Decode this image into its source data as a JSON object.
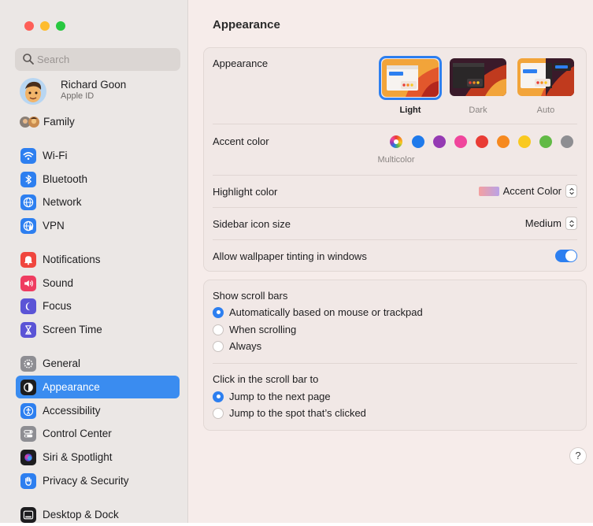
{
  "window": {
    "title": "Appearance"
  },
  "search": {
    "placeholder": "Search"
  },
  "account": {
    "name": "Richard Goon",
    "subtitle": "Apple ID"
  },
  "sidebar": {
    "items": [
      {
        "label": "Family",
        "icon": "family-avatars-icon"
      },
      {
        "label": "Wi-Fi",
        "icon": "wifi-icon"
      },
      {
        "label": "Bluetooth",
        "icon": "bluetooth-icon"
      },
      {
        "label": "Network",
        "icon": "globe-icon"
      },
      {
        "label": "VPN",
        "icon": "vpn-globe-icon"
      },
      {
        "label": "Notifications",
        "icon": "bell-icon"
      },
      {
        "label": "Sound",
        "icon": "speaker-icon"
      },
      {
        "label": "Focus",
        "icon": "moon-icon"
      },
      {
        "label": "Screen Time",
        "icon": "hourglass-icon"
      },
      {
        "label": "General",
        "icon": "gear-icon"
      },
      {
        "label": "Appearance",
        "icon": "appearance-icon",
        "selected": true
      },
      {
        "label": "Accessibility",
        "icon": "accessibility-icon"
      },
      {
        "label": "Control Center",
        "icon": "toggles-icon"
      },
      {
        "label": "Siri & Spotlight",
        "icon": "siri-icon"
      },
      {
        "label": "Privacy & Security",
        "icon": "hand-icon"
      },
      {
        "label": "Desktop & Dock",
        "icon": "dock-icon"
      }
    ]
  },
  "appearance": {
    "label": "Appearance",
    "options": [
      {
        "label": "Light",
        "selected": true
      },
      {
        "label": "Dark",
        "selected": false
      },
      {
        "label": "Auto",
        "selected": false
      }
    ]
  },
  "accent": {
    "label": "Accent color",
    "selected_name": "Multicolor",
    "colors": [
      "multicolor",
      "#1f7aeb",
      "#953ab3",
      "#f0459c",
      "#e93c35",
      "#f6891f",
      "#f9c920",
      "#62ba46",
      "#8e8e92"
    ]
  },
  "highlight": {
    "label": "Highlight color",
    "value": "Accent Color"
  },
  "sidebar_icon_size": {
    "label": "Sidebar icon size",
    "value": "Medium"
  },
  "wallpaper_tinting": {
    "label": "Allow wallpaper tinting in windows",
    "enabled": true
  },
  "scroll_bars": {
    "label": "Show scroll bars",
    "options": [
      {
        "label": "Automatically based on mouse or trackpad",
        "selected": true
      },
      {
        "label": "When scrolling",
        "selected": false
      },
      {
        "label": "Always",
        "selected": false
      }
    ]
  },
  "click_scroll": {
    "label": "Click in the scroll bar to",
    "options": [
      {
        "label": "Jump to the next page",
        "selected": true
      },
      {
        "label": "Jump to the spot that’s clicked",
        "selected": false
      }
    ]
  },
  "help": {
    "label": "?"
  }
}
